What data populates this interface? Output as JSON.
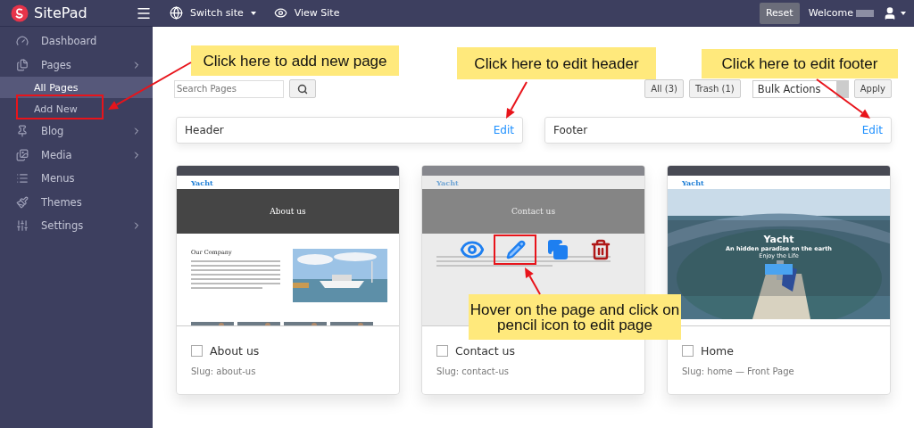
{
  "topbar": {
    "brand": "SitePad",
    "links": [
      {
        "label": "Switch site",
        "dropdown": true
      },
      {
        "label": "View Site",
        "dropdown": false
      }
    ],
    "reset": "Reset",
    "welcome": "Welcome"
  },
  "sidebar": {
    "items": [
      {
        "label": "Dashboard",
        "submenu": false
      },
      {
        "label": "Pages",
        "submenu": true,
        "expanded": true,
        "children": [
          {
            "label": "All Pages",
            "selected": true
          },
          {
            "label": "Add New",
            "selected": false
          }
        ]
      },
      {
        "label": "Blog",
        "submenu": true
      },
      {
        "label": "Media",
        "submenu": true
      },
      {
        "label": "Menus",
        "submenu": false
      },
      {
        "label": "Themes",
        "submenu": false
      },
      {
        "label": "Settings",
        "submenu": true
      }
    ]
  },
  "toolbar": {
    "search": {
      "placeholder": "Search Pages"
    },
    "filters": [
      "All (3)",
      "Trash (1)"
    ],
    "bulk_action": "Bulk Actions",
    "apply": "Apply"
  },
  "sections": [
    {
      "label": "Header",
      "action": "Edit"
    },
    {
      "label": "Footer",
      "action": "Edit"
    }
  ],
  "pages": [
    {
      "title": "About us",
      "slug": "Slug: about-us",
      "checked": false,
      "hovered": false,
      "thumbnail": {
        "kind": "about",
        "brand": "Yacht",
        "heading": "About us",
        "subheading": "Our Company"
      }
    },
    {
      "title": "Contact us",
      "slug": "Slug: contact-us",
      "checked": false,
      "hovered": true,
      "thumbnail": {
        "kind": "contact",
        "brand": "Yacht",
        "heading": "Contact us"
      }
    },
    {
      "title": "Home",
      "slug": "Slug: home — Front Page",
      "checked": false,
      "hovered": false,
      "thumbnail": {
        "kind": "home",
        "brand": "Yacht",
        "heading": "Yacht",
        "tagline": "An hidden paradise on the earth",
        "subtitle": "Enjoy the Life"
      }
    }
  ],
  "annotations": [
    "Click here to add new page",
    "Click here to edit header",
    "Click here to edit footer",
    "Hover on the page and click on pencil icon to edit page"
  ]
}
